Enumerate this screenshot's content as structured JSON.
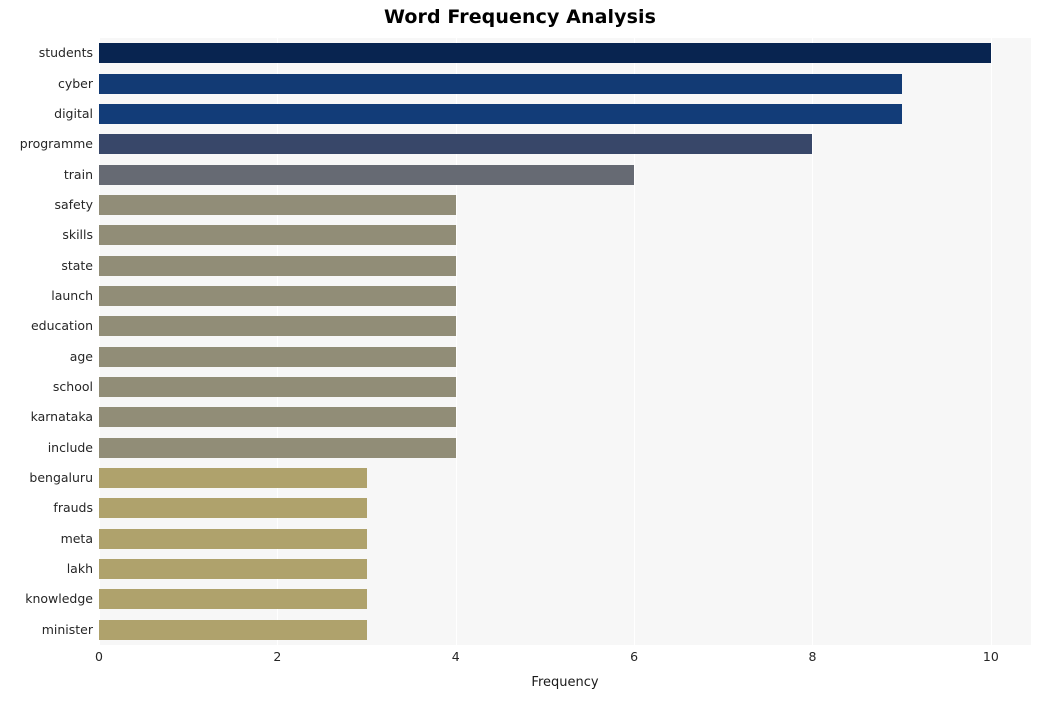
{
  "chart_data": {
    "type": "bar",
    "orientation": "horizontal",
    "title": "Word Frequency Analysis",
    "xlabel": "Frequency",
    "ylabel": "",
    "xlim": [
      0,
      10.45
    ],
    "ylim": [
      0,
      20
    ],
    "grid": true,
    "legend": false,
    "x_ticks": [
      "0",
      "2",
      "4",
      "6",
      "8",
      "10"
    ],
    "x_tick_values": [
      0,
      2,
      4,
      6,
      8,
      10
    ],
    "categories": [
      "students",
      "cyber",
      "digital",
      "programme",
      "train",
      "safety",
      "skills",
      "state",
      "launch",
      "education",
      "age",
      "school",
      "karnataka",
      "include",
      "bengaluru",
      "frauds",
      "meta",
      "lakh",
      "knowledge",
      "minister"
    ],
    "values": [
      10,
      9,
      9,
      8,
      6,
      4,
      4,
      4,
      4,
      4,
      4,
      4,
      4,
      4,
      3,
      3,
      3,
      3,
      3,
      3
    ],
    "bar_colors": [
      "#082450",
      "#123a74",
      "#123c78",
      "#384769",
      "#666a73",
      "#918d78",
      "#918d77",
      "#918d77",
      "#918d77",
      "#918d77",
      "#918d77",
      "#918d77",
      "#918d77",
      "#918d77",
      "#afa26c",
      "#afa26c",
      "#afa26c",
      "#afa26c",
      "#afa26c",
      "#afa26c"
    ],
    "plot_background": "#f7f7f7",
    "gridline_color": "#ffffff",
    "title_color": "#000000",
    "tick_label_color": "#262626"
  }
}
